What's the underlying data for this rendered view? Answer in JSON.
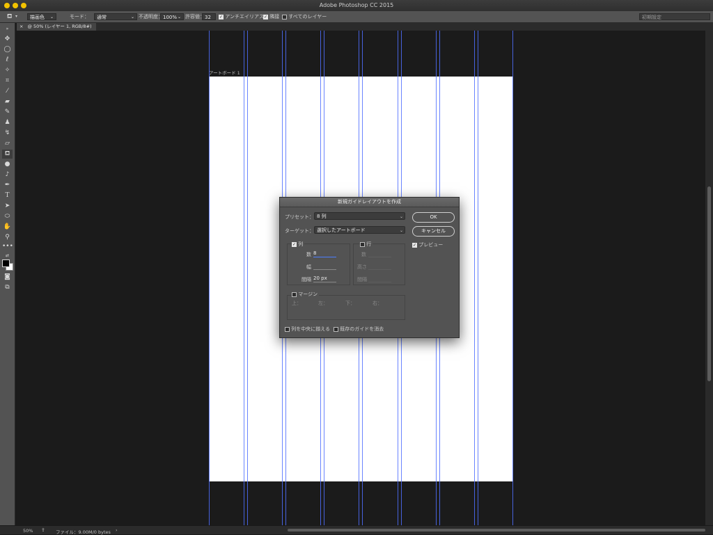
{
  "app": {
    "title": "Adobe Photoshop CC 2015"
  },
  "options": {
    "fill_source": "描画色",
    "mode_label": "モード：",
    "mode_value": "通常",
    "opacity_label": "不透明度：",
    "opacity_value": "100%",
    "tolerance_label": "許容値：",
    "tolerance_value": "32",
    "antialias_label": "アンチエイリアス",
    "contiguous_label": "隣接",
    "all_layers_label": "すべてのレイヤー",
    "workspace": "初期設定"
  },
  "document": {
    "tab_label": "@ 50% (レイヤー 1, RGB/8#)",
    "artboard_label": "アートボード 1"
  },
  "status": {
    "zoom": "50%",
    "file_info": "ファイル：9.00M/0 bytes"
  },
  "dialog": {
    "title": "新規ガイドレイアウトを作成",
    "preset_label": "プリセット：",
    "preset_value": "8 列",
    "target_label": "ターゲット：",
    "target_value": "選択したアートボード",
    "ok_label": "OK",
    "cancel_label": "キャンセル",
    "preview_label": "プレビュー",
    "columns": {
      "label": "列",
      "count_label": "数",
      "count_value": "8",
      "width_label": "幅",
      "gutter_label": "間隔",
      "gutter_value": "20 px"
    },
    "rows": {
      "label": "行",
      "count_label": "数",
      "height_label": "高さ",
      "gutter_label": "間隔"
    },
    "margin": {
      "label": "マージン",
      "top": "上：",
      "left": "左：",
      "bottom": "下：",
      "right": "右："
    },
    "center_columns_label": "列を中央に揃える",
    "clear_guides_label": "既存のガイドを消去"
  },
  "colors": {
    "guide": "#4f6fff",
    "accent_focus": "#4d7fff",
    "traffic": "#f2c200"
  }
}
